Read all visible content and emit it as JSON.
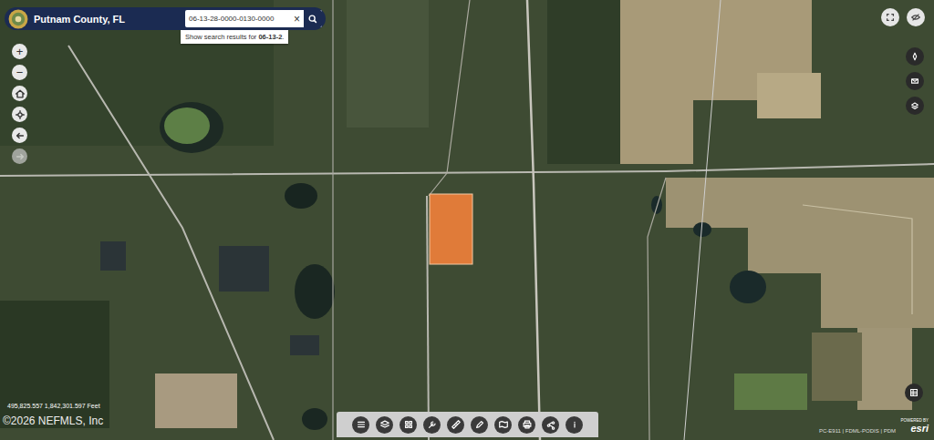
{
  "header": {
    "title": "Putnam County, FL"
  },
  "search": {
    "value": "06-13-28-0000-0130-0000",
    "clear": "×",
    "suggestion": {
      "prefix": "Show search results for ",
      "query": "06-13-2",
      "suffix": "."
    }
  },
  "zoom": [
    "+",
    "−"
  ],
  "nav_buttons": [
    {
      "disabled": false
    },
    {
      "disabled": false
    },
    {
      "disabled": false
    },
    {
      "disabled": true
    }
  ],
  "coordinates": "495,825.557 1,842,301.597 Feet",
  "copyright": "©2026 NEFMLS, Inc",
  "attribution": "PC-E911 | FDML-PODIS | PDM",
  "esri": {
    "powered_by": "POWERED BY",
    "logo": "esri"
  }
}
